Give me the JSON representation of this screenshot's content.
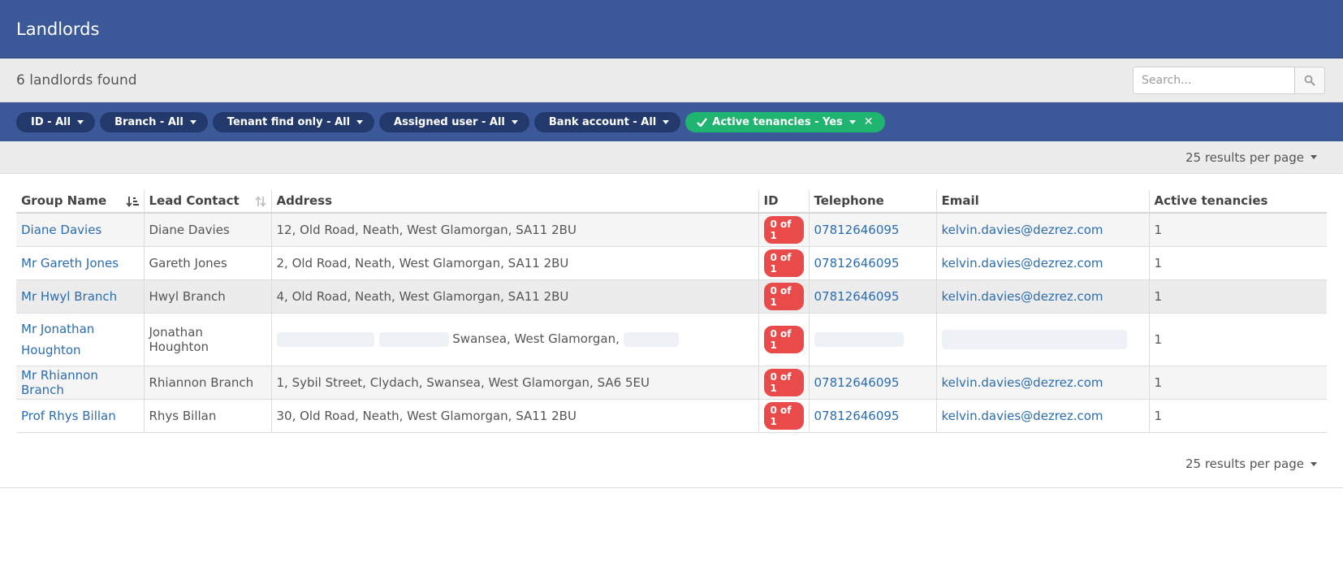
{
  "header": {
    "title": "Landlords"
  },
  "summary": {
    "count_text": "6 landlords found"
  },
  "search": {
    "placeholder": "Search...",
    "icon": "search-icon"
  },
  "filters": [
    {
      "label": "ID - All"
    },
    {
      "label": "Branch - All"
    },
    {
      "label": "Tenant find only - All"
    },
    {
      "label": "Assigned user - All"
    },
    {
      "label": "Bank account - All"
    },
    {
      "label": "Active tenancies - Yes",
      "active": true
    }
  ],
  "pagination": {
    "results_per_page": "25 results per page"
  },
  "table": {
    "columns": [
      "Group Name",
      "Lead Contact",
      "Address",
      "ID",
      "Telephone",
      "Email",
      "Active tenancies"
    ],
    "rows": [
      {
        "group_name": "Diane Davies",
        "lead_contact": "Diane Davies",
        "address": "12, Old Road, Neath, West Glamorgan, SA11 2BU",
        "id_badge": "0 of 1",
        "telephone": "07812646095",
        "email": "kelvin.davies@dezrez.com",
        "active_tenancies": "1"
      },
      {
        "group_name": "Mr Gareth Jones",
        "lead_contact": "Gareth Jones",
        "address": "2, Old Road, Neath, West Glamorgan, SA11 2BU",
        "id_badge": "0 of 1",
        "telephone": "07812646095",
        "email": "kelvin.davies@dezrez.com",
        "active_tenancies": "1"
      },
      {
        "group_name": "Mr Hwyl Branch",
        "lead_contact": "Hwyl Branch",
        "address": "4, Old Road, Neath, West Glamorgan, SA11 2BU",
        "id_badge": "0 of 1",
        "telephone": "07812646095",
        "email": "kelvin.davies@dezrez.com",
        "active_tenancies": "1"
      },
      {
        "group_name": "Mr Jonathan Houghton",
        "lead_contact": "Jonathan Houghton",
        "address": "Swansea, West Glamorgan,",
        "id_badge": "0 of 1",
        "telephone": "",
        "email": "",
        "active_tenancies": "1"
      },
      {
        "group_name": "Mr Rhiannon Branch",
        "lead_contact": "Rhiannon Branch",
        "address": "1, Sybil Street, Clydach, Swansea, West Glamorgan, SA6 5EU",
        "id_badge": "0 of 1",
        "telephone": "07812646095",
        "email": "kelvin.davies@dezrez.com",
        "active_tenancies": "1"
      },
      {
        "group_name": "Prof Rhys Billan",
        "lead_contact": "Rhys Billan",
        "address": "30, Old Road, Neath, West Glamorgan, SA11 2BU",
        "id_badge": "0 of 1",
        "telephone": "07812646095",
        "email": "kelvin.davies@dezrez.com",
        "active_tenancies": "1"
      }
    ]
  },
  "colors": {
    "header_blue": "#3b5998",
    "pill_dark": "#23396b",
    "active_green": "#1fb46f",
    "badge_red": "#e94b4b",
    "link_blue": "#2b6cb0"
  }
}
